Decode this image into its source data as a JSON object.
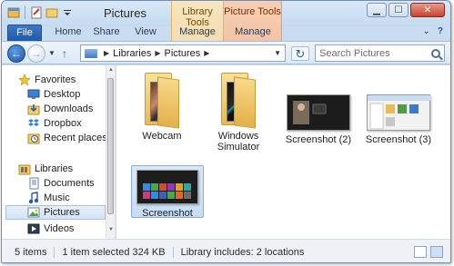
{
  "window": {
    "title": "Pictures",
    "contextual_groups": [
      "Library Tools",
      "Picture Tools"
    ]
  },
  "ribbon": {
    "tabs": [
      "File",
      "Home",
      "Share",
      "View",
      "Manage",
      "Manage"
    ],
    "help": "?"
  },
  "address_bar": {
    "breadcrumb": [
      "Libraries",
      "Pictures"
    ]
  },
  "search": {
    "placeholder": "Search Pictures"
  },
  "sidebar": {
    "favorites_label": "Favorites",
    "favorites": [
      "Desktop",
      "Downloads",
      "Dropbox",
      "Recent places"
    ],
    "libraries_label": "Libraries",
    "libraries": [
      "Documents",
      "Music",
      "Pictures",
      "Videos"
    ],
    "selected": "Pictures"
  },
  "content": {
    "items": [
      {
        "name": "Webcam",
        "kind": "folder"
      },
      {
        "name": "Windows Simulator",
        "kind": "folder"
      },
      {
        "name": "Screenshot (2)",
        "kind": "image"
      },
      {
        "name": "Screenshot (3)",
        "kind": "image"
      },
      {
        "name": "Screenshot",
        "kind": "image",
        "selected": true
      }
    ]
  },
  "status": {
    "item_count": "5 items",
    "selection": "1 item selected  324 KB",
    "library_info": "Library includes: 2 locations"
  },
  "colors": {
    "accent": "#1f5aa8",
    "library_tools": "#f4ddb2",
    "picture_tools": "#f3c3a4",
    "selection": "#c7ddf4"
  }
}
